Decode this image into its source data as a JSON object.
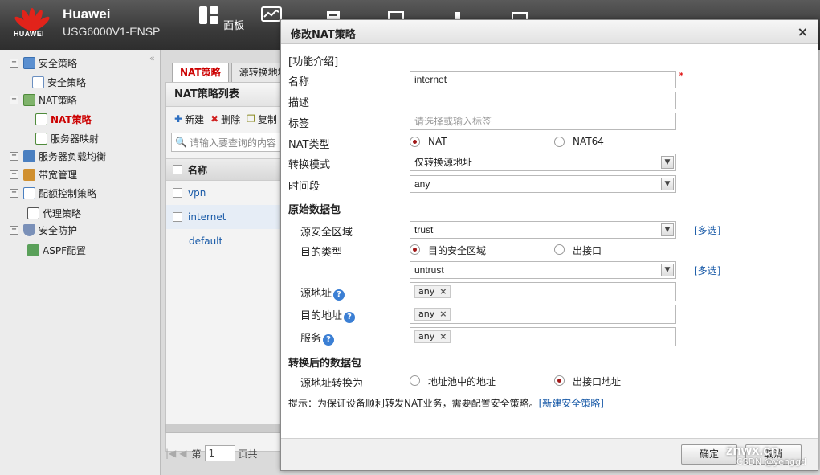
{
  "header": {
    "logo_text": "HUAWEI",
    "brand": "Huawei",
    "model": "USG6000V1-ENSP",
    "nav": [
      {
        "label": "面板",
        "icon": "dashboard-icon"
      },
      {
        "label": "监控",
        "icon": "monitor-icon"
      }
    ]
  },
  "sidebar": {
    "items": [
      {
        "label": "安全策略",
        "expander": "−",
        "icon": "security-policy-icon"
      },
      {
        "label": "安全策略",
        "icon": "policy-doc-icon"
      },
      {
        "label": "NAT策略",
        "expander": "−",
        "icon": "nat-policy-icon"
      },
      {
        "label": "NAT策略",
        "icon": "nat-icon"
      },
      {
        "label": "服务器映射",
        "icon": "server-map-icon"
      },
      {
        "label": "服务器负载均衡",
        "expander": "+",
        "icon": "load-balance-icon"
      },
      {
        "label": "带宽管理",
        "expander": "+",
        "icon": "bandwidth-icon"
      },
      {
        "label": "配额控制策略",
        "expander": "+",
        "icon": "quota-icon"
      },
      {
        "label": "代理策略",
        "icon": "proxy-icon"
      },
      {
        "label": "安全防护",
        "expander": "+",
        "icon": "shield-icon"
      },
      {
        "label": "ASPF配置",
        "icon": "aspf-icon"
      }
    ]
  },
  "main": {
    "tabs": [
      {
        "label": "NAT策略"
      },
      {
        "label": "源转换地址"
      }
    ],
    "panel_title": "NAT策略列表",
    "toolbar": {
      "new": "新建",
      "delete": "删除",
      "copy": "复制"
    },
    "search_placeholder": "请输入要查询的内容",
    "table": {
      "header": "名称",
      "rows": [
        "vpn",
        "internet",
        "default"
      ]
    },
    "pager": {
      "page_prefix": "第",
      "page_value": "1",
      "page_suffix": "页共"
    }
  },
  "dialog": {
    "title": "修改NAT策略",
    "intro_link": "[功能介绍]",
    "fields": {
      "name_label": "名称",
      "name_value": "internet",
      "desc_label": "描述",
      "desc_value": "",
      "tag_label": "标签",
      "tag_placeholder": "请选择或输入标签",
      "nat_type_label": "NAT类型",
      "nat_type_opt1": "NAT",
      "nat_type_opt2": "NAT64",
      "mode_label": "转换模式",
      "mode_value": "仅转换源地址",
      "time_label": "时间段",
      "time_value": "any"
    },
    "original_section": "原始数据包",
    "original": {
      "src_zone_label": "源安全区域",
      "src_zone_value": "trust",
      "multi_select": "[多选]",
      "dst_type_label": "目的类型",
      "dst_type_opt1": "目的安全区域",
      "dst_type_opt2": "出接口",
      "dst_zone_value": "untrust",
      "src_addr_label": "源地址",
      "src_addr_tag": "any",
      "dst_addr_label": "目的地址",
      "dst_addr_tag": "any",
      "service_label": "服务",
      "service_tag": "any",
      "help_glyph": "?",
      "remove_glyph": "×"
    },
    "translated_section": "转换后的数据包",
    "translated": {
      "src_xlate_label": "源地址转换为",
      "opt1": "地址池中的地址",
      "opt2": "出接口地址"
    },
    "hint": "提示：为保证设备顺利转发NAT业务，需要配置安全策略。",
    "hint_link": "[新建安全策略]",
    "ok": "确定",
    "cancel": "取消",
    "close": "×"
  },
  "watermark": {
    "main": "znwx.cn",
    "sub": "CSDN @yenggd"
  },
  "colors": {
    "accent_red": "#c00000",
    "link_blue": "#1a5ba8",
    "radio_dot": "#a01818"
  }
}
